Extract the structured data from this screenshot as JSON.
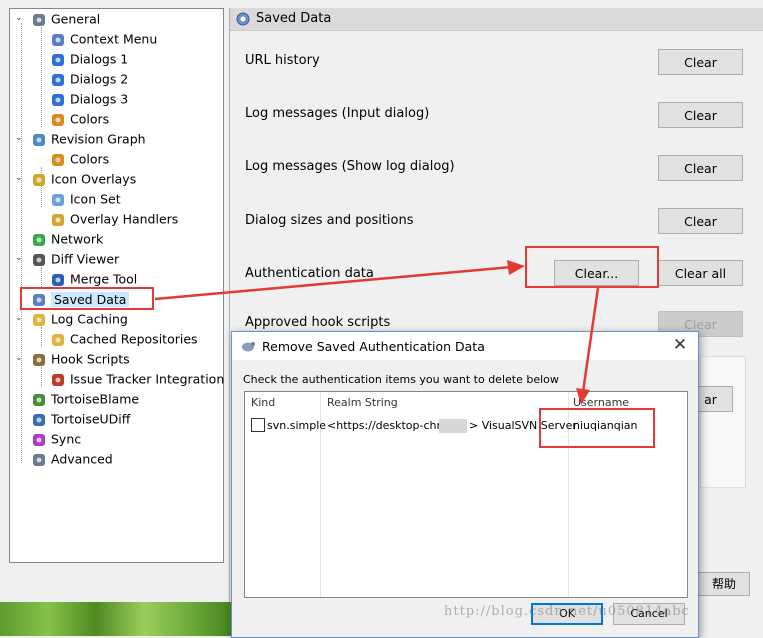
{
  "tree": {
    "items": [
      {
        "label": "General",
        "icon": "wrench-icon"
      },
      {
        "label": "Context Menu",
        "icon": "gear-icon"
      },
      {
        "label": "Dialogs 1",
        "icon": "dialogs-icon"
      },
      {
        "label": "Dialogs 2",
        "icon": "dialogs-icon"
      },
      {
        "label": "Dialogs 3",
        "icon": "dialogs-icon"
      },
      {
        "label": "Colors",
        "icon": "palette-icon"
      },
      {
        "label": "Revision Graph",
        "icon": "graph-icon"
      },
      {
        "label": "Colors",
        "icon": "palette-icon"
      },
      {
        "label": "Icon Overlays",
        "icon": "overlay-icon"
      },
      {
        "label": "Icon Set",
        "icon": "iconset-icon"
      },
      {
        "label": "Overlay Handlers",
        "icon": "overlay-icon"
      },
      {
        "label": "Network",
        "icon": "globe-icon"
      },
      {
        "label": "Diff Viewer",
        "icon": "magnifier-icon"
      },
      {
        "label": "Merge Tool",
        "icon": "merge-icon"
      },
      {
        "label": "Saved Data",
        "icon": "gear-icon"
      },
      {
        "label": "Log Caching",
        "icon": "database-icon"
      },
      {
        "label": "Cached Repositories",
        "icon": "database-icon"
      },
      {
        "label": "Hook Scripts",
        "icon": "hook-icon"
      },
      {
        "label": "Issue Tracker Integration",
        "icon": "bug-icon"
      },
      {
        "label": "TortoiseBlame",
        "icon": "blame-icon"
      },
      {
        "label": "TortoiseUDiff",
        "icon": "udiff-icon"
      },
      {
        "label": "Sync",
        "icon": "sync-icon"
      },
      {
        "label": "Advanced",
        "icon": "wrench-icon"
      }
    ]
  },
  "panel": {
    "title": "Saved Data",
    "rows": [
      {
        "label": "URL history",
        "button": "Clear"
      },
      {
        "label": "Log messages (Input dialog)",
        "button": "Clear"
      },
      {
        "label": "Log messages (Show log dialog)",
        "button": "Clear"
      },
      {
        "label": "Dialog sizes and positions",
        "button": "Clear"
      },
      {
        "label": "Authentication data",
        "button": "Clear...",
        "button2": "Clear all"
      },
      {
        "label": "Approved hook scripts",
        "button": "Clear"
      }
    ],
    "partial_button": "ar",
    "help_button": "帮助"
  },
  "dialog": {
    "title": "Remove Saved Authentication Data",
    "instructions": "Check the authentication items you want to delete below",
    "columns": [
      "Kind",
      "Realm String",
      "Username"
    ],
    "row": {
      "kind": "svn.simple",
      "realm": "<https://desktop-chrpc",
      "realm_suffix": "> VisualSVN Server",
      "username": "niuqianqian"
    },
    "ok": "OK",
    "cancel": "Cancel"
  },
  "watermark": "http://blog.csdn.net/u050814abc",
  "colors": {
    "annotation": "#e53935",
    "selection": "#cce8ff",
    "accent": "#0078d7"
  }
}
